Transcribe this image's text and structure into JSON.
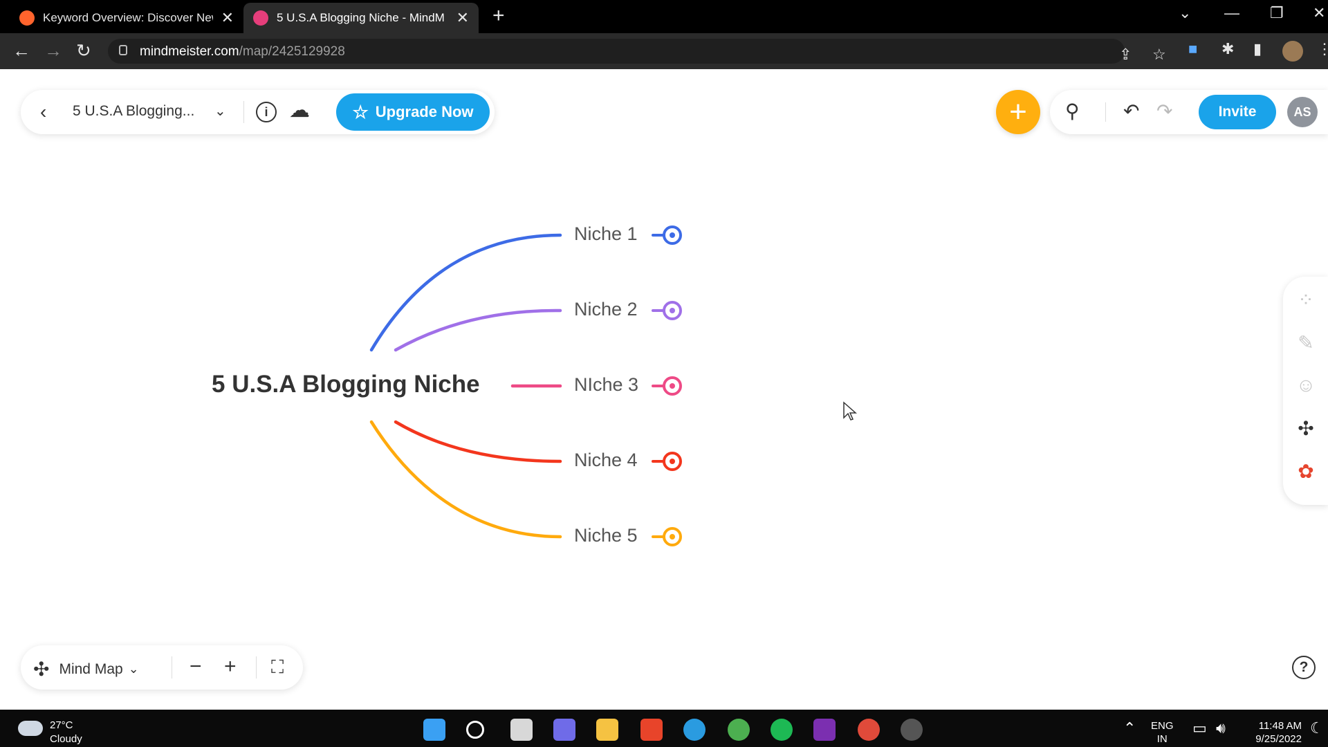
{
  "browser": {
    "tabs": [
      {
        "title": "Keyword Overview: Discover New",
        "active": false,
        "favicon_color": "#ff642d"
      },
      {
        "title": "5 U.S.A Blogging Niche - MindM",
        "active": true,
        "favicon_color": "#e63e7b"
      }
    ],
    "url_host": "mindmeister.com",
    "url_path": "/map/2425129928"
  },
  "toolbar": {
    "map_title": "5 U.S.A Blogging...",
    "upgrade_label": "Upgrade Now",
    "invite_label": "Invite",
    "avatar_initials": "AS"
  },
  "map": {
    "root": "5 U.S.A Blogging Niche",
    "topics": [
      {
        "label": "Niche 1",
        "color": "#3d6be6"
      },
      {
        "label": "Niche 2",
        "color": "#a070e8"
      },
      {
        "label": "NIche 3",
        "color": "#ee4a86"
      },
      {
        "label": "Niche 4",
        "color": "#f3361d"
      },
      {
        "label": "Niche 5",
        "color": "#ffaa0d"
      }
    ]
  },
  "bottom_toolbar": {
    "layout_label": "Mind Map"
  },
  "taskbar": {
    "weather_temp": "27°C",
    "weather_desc": "Cloudy",
    "lang_1": "ENG",
    "lang_2": "IN",
    "time": "11:48 AM",
    "date": "9/25/2022"
  },
  "colors": {
    "accent_blue": "#1aa3ea",
    "accent_orange": "#ffaf0f"
  }
}
